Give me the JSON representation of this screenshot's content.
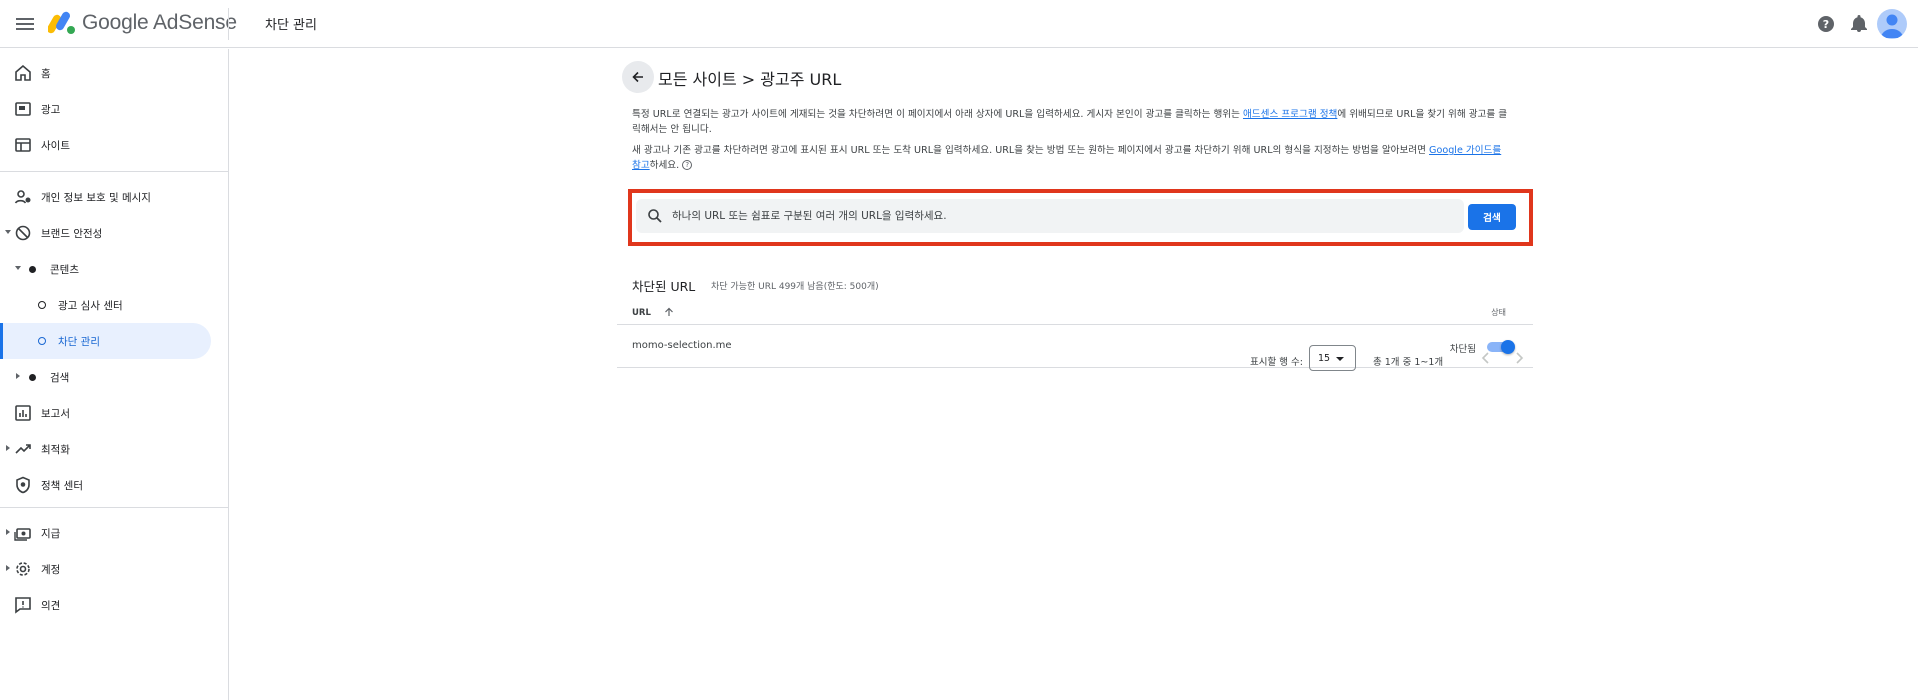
{
  "header": {
    "brand": "Google AdSense",
    "page_title": "차단 관리"
  },
  "sidebar": {
    "home": "홈",
    "ads": "광고",
    "sites": "사이트",
    "privacy": "개인 정보 보호 및 메시지",
    "brand_safety": "브랜드 안전성",
    "content": "콘텐츠",
    "ad_review": "광고 심사 센터",
    "blocking": "차단 관리",
    "search": "검색",
    "reports": "보고서",
    "optimization": "최적화",
    "policy": "정책 센터",
    "payments": "지급",
    "account": "계정",
    "feedback": "의견"
  },
  "main": {
    "heading": "모든 사이트 > 광고주 URL",
    "desc1_pre": "특정 URL로 연결되는 광고가 사이트에 게재되는 것을 차단하려면 이 페이지에서 아래 상자에 URL을 입력하세요. 게시자 본인이 광고를 클릭하는 행위는 ",
    "desc1_link": "애드센스 프로그램 정책",
    "desc1_post": "에 위배되므로 URL을 찾기 위해 광고를 클릭해서는 안 됩니다.",
    "desc2_pre": "새 광고나 기존 광고를 차단하려면 광고에 표시된 표시 URL 또는 도착 URL을 입력하세요. URL을 찾는 방법 또는 원하는 페이지에서 광고를 차단하기 위해 URL의 형식을 지정하는 방법을 알아보려면 ",
    "desc2_link": "Google 가이드를 참고",
    "desc2_post": "하세요.",
    "help_glyph": "?",
    "search_placeholder": "하나의 URL 또는 쉼표로 구분된 여러 개의 URL을 입력하세요.",
    "search_button": "검색",
    "section_title": "차단된 URL",
    "section_sub": "차단 가능한 URL 499개 남음(한도: 500개)",
    "table": {
      "col_url": "URL",
      "col_status": "상태",
      "rows": [
        {
          "url": "momo-selection.me",
          "status": "차단됨",
          "toggle_on": true
        }
      ]
    },
    "pager": {
      "rows_label": "표시할 행 수:",
      "rows_value": "15",
      "range": "총 1개 중 1~1개"
    }
  },
  "colors": {
    "accent": "#1a73e8",
    "highlight": "#e0361c",
    "active_nav_bg": "#e8f0fe"
  },
  "icons": [
    "menu-icon",
    "adsense-logo",
    "help-icon",
    "bell-icon",
    "account-avatar",
    "back-arrow-icon",
    "search-icon",
    "sort-up-icon",
    "chevron-left-icon",
    "chevron-right-icon"
  ]
}
